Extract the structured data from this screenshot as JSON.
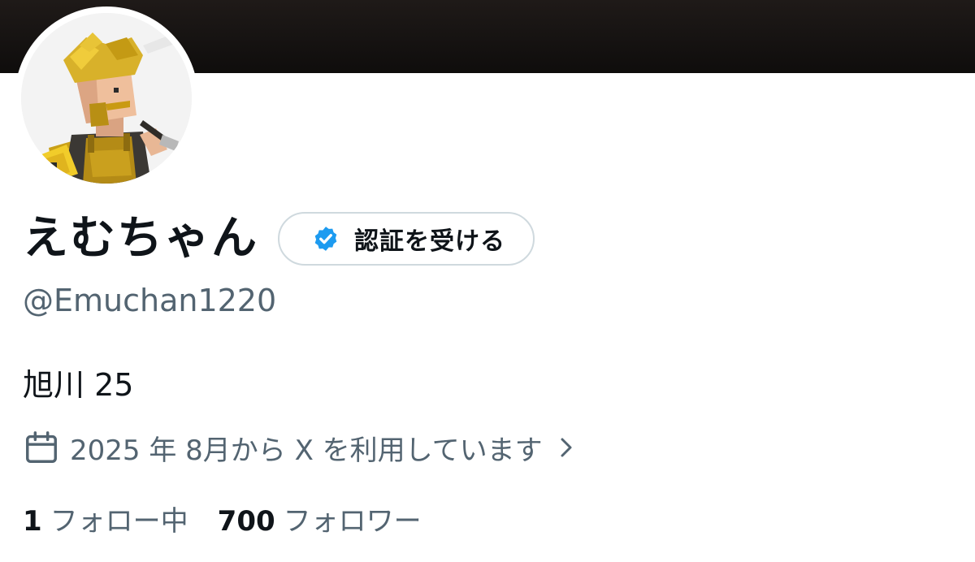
{
  "profile": {
    "display_name": "えむちゃん",
    "handle": "@Emuchan1220",
    "bio": "旭川 25",
    "joined": "2025 年 8月から X を利用しています",
    "verify_button_label": "認証を受ける"
  },
  "stats": {
    "following_count": "1",
    "following_label": "フォロー中",
    "followers_count": "700",
    "followers_label": "フォロワー"
  },
  "icons": {
    "verify": "verified-badge-icon",
    "joined": "calendar-icon",
    "chevron": "chevron-right-icon"
  },
  "colors": {
    "verified_blue": "#1d9bf0",
    "secondary_text": "#536471",
    "primary_text": "#0f1419",
    "button_border": "#cfd9de",
    "banner": "#151211"
  }
}
